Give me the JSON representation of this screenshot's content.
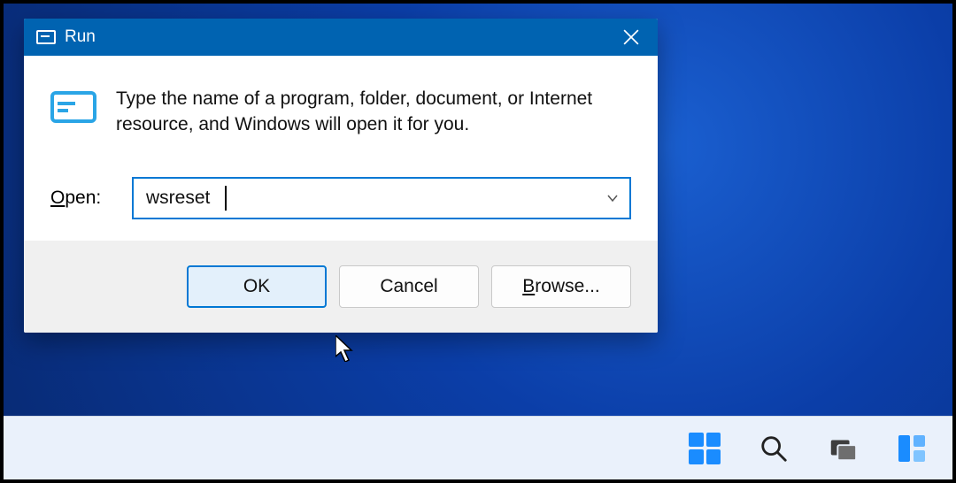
{
  "dialog": {
    "title": "Run",
    "description": "Type the name of a program, folder, document, or Internet resource, and Windows will open it for you.",
    "open_label_prefix": "O",
    "open_label_rest": "pen:",
    "input_value": "wsreset",
    "buttons": {
      "ok": "OK",
      "cancel": "Cancel",
      "browse_prefix": "B",
      "browse_rest": "rowse..."
    }
  },
  "icons": {
    "run_title": "run-dialog-icon",
    "close": "close-icon",
    "run_body": "run-prompt-icon",
    "caret": "chevron-down-icon",
    "start": "start-icon",
    "search": "search-icon",
    "taskview": "task-view-icon",
    "widgets": "widgets-icon"
  }
}
